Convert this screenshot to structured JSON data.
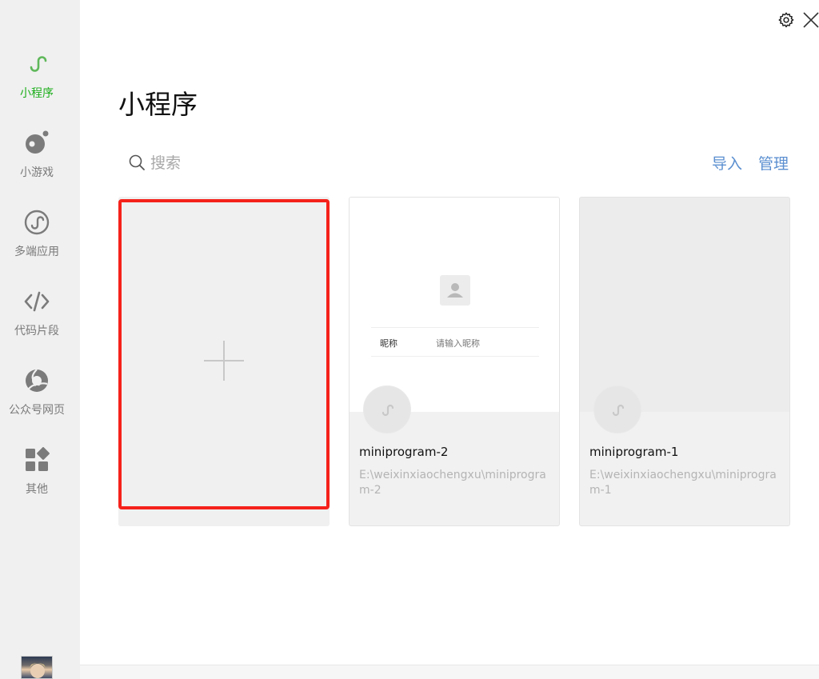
{
  "sidebar": {
    "items": [
      {
        "label": "小程序",
        "icon": "miniprogram-icon",
        "active": true
      },
      {
        "label": "小游戏",
        "icon": "minigame-icon",
        "active": false
      },
      {
        "label": "多端应用",
        "icon": "multi-platform-icon",
        "active": false
      },
      {
        "label": "代码片段",
        "icon": "code-icon",
        "active": false
      },
      {
        "label": "公众号网页",
        "icon": "official-account-icon",
        "active": false
      },
      {
        "label": "其他",
        "icon": "apps-icon",
        "active": false
      }
    ],
    "avatar_icon": "user-avatar"
  },
  "header": {
    "title": "小程序",
    "settings_icon": "gear-icon",
    "close_icon": "close-icon"
  },
  "search": {
    "placeholder": "搜索",
    "value": ""
  },
  "actions": {
    "import_label": "导入",
    "manage_label": "管理"
  },
  "colors": {
    "accent_green": "#1aad19",
    "link_blue": "#5b8fd0",
    "highlight_red": "#f5221b"
  },
  "projects": [
    {
      "name": "miniprogram-2",
      "path": "E:\\weixinxiaochengxu\\miniprogram-2",
      "preview": {
        "field_label": "昵称",
        "field_placeholder": "请输入昵称"
      }
    },
    {
      "name": "miniprogram-1",
      "path": "E:\\weixinxiaochengxu\\miniprogram-1"
    }
  ]
}
